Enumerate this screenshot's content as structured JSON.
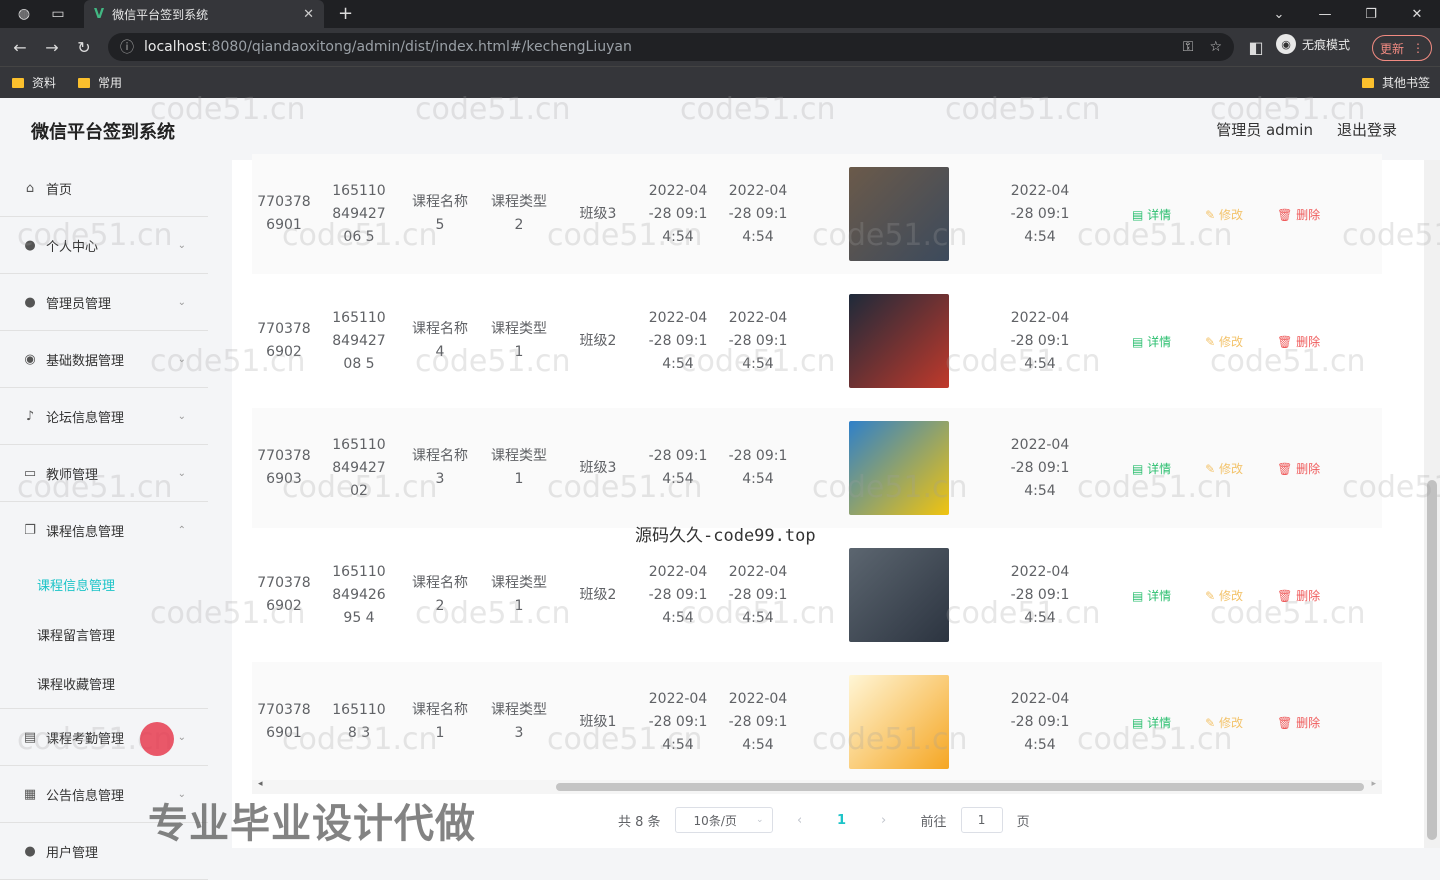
{
  "browser": {
    "tab_title": "微信平台签到系统",
    "url_host": "localhost",
    "url_path": ":8080/qiandaoxitong/admin/dist/index.html#/kechengLiuyan",
    "incognito_label": "无痕模式",
    "update_label": "更新",
    "bookmarks": [
      "资料",
      "常用"
    ],
    "other_bookmarks": "其他书签"
  },
  "header": {
    "brand": "微信平台签到系统",
    "user_label": "管理员 admin",
    "logout_label": "退出登录"
  },
  "sidebar": {
    "items": [
      {
        "label": "首页",
        "icon": "home-icon"
      },
      {
        "label": "个人中心",
        "icon": "user-icon"
      },
      {
        "label": "管理员管理",
        "icon": "user-icon"
      },
      {
        "label": "基础数据管理",
        "icon": "location-icon"
      },
      {
        "label": "论坛信息管理",
        "icon": "mic-icon"
      },
      {
        "label": "教师管理",
        "icon": "chat-icon"
      },
      {
        "label": "课程信息管理",
        "icon": "copy-icon"
      }
    ],
    "submenu": [
      "课程信息管理",
      "课程留言管理",
      "课程收藏管理"
    ],
    "items_after": [
      {
        "label": "课程考勤管理",
        "icon": "clipboard-icon"
      },
      {
        "label": "公告信息管理",
        "icon": "grid-icon"
      },
      {
        "label": "用户管理",
        "icon": "user-icon"
      }
    ]
  },
  "table": {
    "rows": [
      {
        "id": "7703786901",
        "phone": "16511084942706 5",
        "name": "课程名称 5",
        "type": "课程类型 2",
        "class": "班级3",
        "t1": "2022-04 -28 09:1 4:54",
        "t2": "2022-04 -28 09:1 4:54",
        "t3": "2022-04 -28 09:1 4:54"
      },
      {
        "id": "7703786902",
        "phone": "16511084942708 5",
        "name": "课程名称 4",
        "type": "课程类型 1",
        "class": "班级2",
        "t1": "2022-04 -28 09:1 4:54",
        "t2": "2022-04 -28 09:1 4:54",
        "t3": "2022-04 -28 09:1 4:54"
      },
      {
        "id": "7703786903",
        "phone": "16511084942702",
        "name": "课程名称 3",
        "type": "课程类型 1",
        "class": "班级3",
        "t1": "-28 09:1 4:54",
        "t2": "-28 09:1 4:54",
        "t3": "2022-04 -28 09:1 4:54"
      },
      {
        "id": "7703786902",
        "phone": "16511084942695 4",
        "name": "课程名称 2",
        "type": "课程类型 1",
        "class": "班级2",
        "t1": "2022-04 -28 09:1 4:54",
        "t2": "2022-04 -28 09:1 4:54",
        "t3": "2022-04 -28 09:1 4:54"
      },
      {
        "id": "7703786901",
        "phone": "1651108 3",
        "name": "课程名称 1",
        "type": "课程类型 3",
        "class": "班级1",
        "t1": "2022-04 -28 09:1 4:54",
        "t2": "2022-04 -28 09:1 4:54",
        "t3": "2022-04 -28 09:1 4:54"
      }
    ],
    "actions": {
      "detail": "详情",
      "edit": "修改",
      "delete": "删除"
    }
  },
  "pagination": {
    "total": "共 8 条",
    "page_size": "10条/页",
    "current": "1",
    "goto_prefix": "前往",
    "goto_value": "1",
    "goto_suffix": "页"
  },
  "overlays": {
    "site_text": "源码久久-code99.top",
    "promo_text": "专业毕业设计代做",
    "watermark": "code51.cn"
  },
  "colors": {
    "accent": "#1dc4c8",
    "detail": "#2bbf6f",
    "edit": "#f3c36b",
    "delete": "#ef5b5b"
  }
}
